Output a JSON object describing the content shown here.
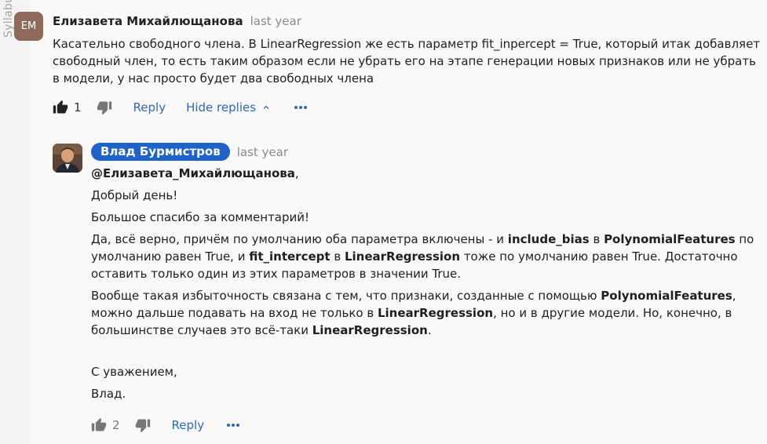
{
  "sidebar": {
    "vertical_text": "Syllabus"
  },
  "comment": {
    "initials": "ЕМ",
    "author": "Елизавета Михайлющанова",
    "time": "last year",
    "text": "Касательно свободного члена. В LinearRegression же есть параметр fit_inpercept = True, который итак добавляет свободный член, то есть таким образом если не убрать его на этапе генерации новых признаков или не убрать в модели, у нас просто будет два свободных члена",
    "likes": "1",
    "reply_label": "Reply",
    "hide_replies_label": "Hide replies"
  },
  "reply": {
    "author": "Влад Бурмистров",
    "time": "last year",
    "mention": "@Елизавета_Михайлющанова",
    "mention_suffix": ",",
    "greeting": "Добрый день!",
    "thanks": "Большое спасибо за комментарий!",
    "p1": {
      "t1": "Да, всё верно, причём по умолчанию оба параметра включены - и ",
      "b1": "include_bias",
      "t2": " в ",
      "b2": "PolynomialFeatures",
      "t3": " по умолчанию равен True, и ",
      "b3": "fit_intercept",
      "t4": " в ",
      "b4": "LinearRegression",
      "t5": " тоже по умолчанию равен True. Достаточно оставить только один из этих параметров в значении True."
    },
    "p2": {
      "t1": "Вообще такая избыточность связана с тем, что признаки, созданные с помощью ",
      "b1": "PolynomialFeatures",
      "t2": ", можно дальше подавать на вход не только в ",
      "b2": "LinearRegression",
      "t3": ", но и в другие модели. Но, конечно, в большинстве случаев это всё-таки ",
      "b3": "LinearRegression",
      "t4": "."
    },
    "signoff": "С уважением,",
    "signature": "Влад.",
    "likes": "2",
    "reply_label": "Reply"
  },
  "colors": {
    "link": "#2f67b8",
    "badge": "#1f63c9",
    "avatar": "#8f6a5a"
  },
  "icons": [
    "thumbs-up-icon",
    "thumbs-down-icon",
    "chevron-up-icon",
    "more-icon"
  ]
}
